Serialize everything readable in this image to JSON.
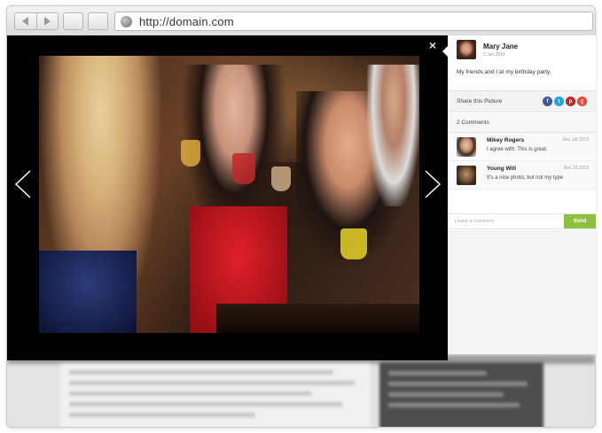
{
  "browser": {
    "url": "http://domain.com"
  },
  "lightbox": {
    "close_label": "×",
    "image_description": "group of friends toasting at a party"
  },
  "panel": {
    "author": {
      "name": "Mary Jane",
      "date": "3 Jan 2014"
    },
    "caption": "My friends and I at my birthday party.",
    "share_label": "Share this Picture",
    "social": [
      {
        "icon": "facebook-icon",
        "glyph": "f",
        "color": "#3b5998"
      },
      {
        "icon": "twitter-icon",
        "glyph": "t",
        "color": "#1da1f2"
      },
      {
        "icon": "pinterest-icon",
        "glyph": "p",
        "color": "#cb2027"
      },
      {
        "icon": "googleplus-icon",
        "glyph": "g",
        "color": "#dd4b39"
      }
    ],
    "comments_count_label": "2 Comments",
    "comments": [
      {
        "name": "Mikey Rogers",
        "date": "Dec 1st 2013",
        "text": "I agree with. This is great."
      },
      {
        "name": "Young Will",
        "date": "Dec 16 2013",
        "text": "It's a nice photo, but not my type"
      }
    ],
    "comment_placeholder": "Leave a comment",
    "send_label": "Send"
  },
  "colors": {
    "send": "#8cc23f",
    "lightbox_bg": "#000000"
  }
}
